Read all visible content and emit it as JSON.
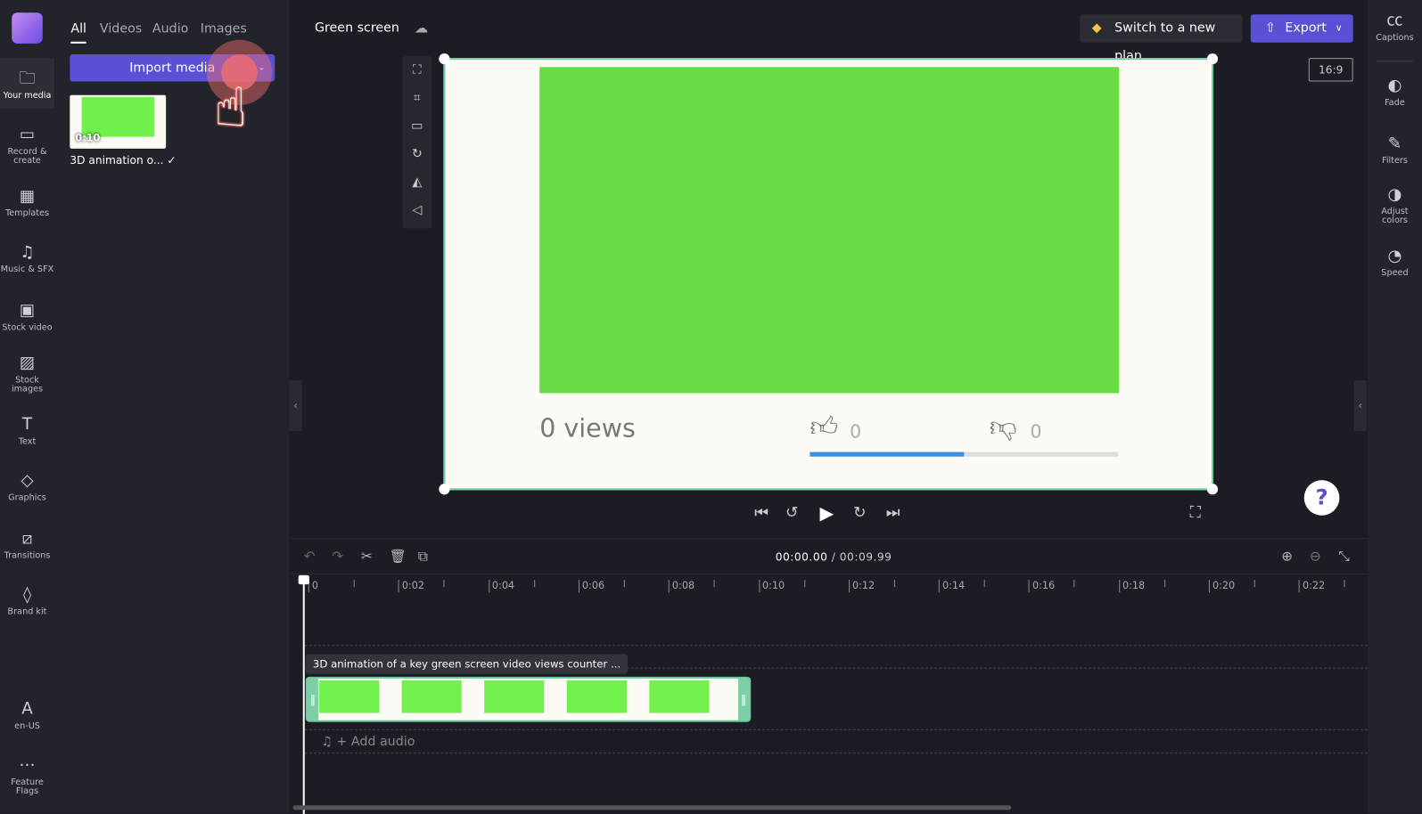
{
  "nav": [
    {
      "label": "Your media",
      "icon": "folder-icon"
    },
    {
      "label": "Record & create",
      "icon": "camera-icon"
    },
    {
      "label": "Templates",
      "icon": "templates-icon"
    },
    {
      "label": "Music & SFX",
      "icon": "music-icon"
    },
    {
      "label": "Stock video",
      "icon": "film-icon"
    },
    {
      "label": "Stock images",
      "icon": "image-icon"
    },
    {
      "label": "Text",
      "icon": "text-icon"
    },
    {
      "label": "Graphics",
      "icon": "shapes-icon"
    },
    {
      "label": "Transitions",
      "icon": "transitions-icon"
    },
    {
      "label": "Brand kit",
      "icon": "brand-icon"
    },
    {
      "label": "en-US",
      "icon": "language-icon"
    },
    {
      "label": "Feature Flags",
      "icon": "more-icon"
    }
  ],
  "panel": {
    "tabs": [
      "All",
      "Videos",
      "Audio",
      "Images"
    ],
    "import_label": "Import media",
    "media": [
      {
        "duration": "0:10",
        "name": "3D animation o..."
      }
    ]
  },
  "header": {
    "project_title": "Green screen",
    "plan_label": "Switch to a new plan",
    "export_label": "Export",
    "aspect_ratio": "16:9"
  },
  "preview": {
    "views_text": "0 views",
    "likes": "0",
    "dislikes": "0",
    "like_ratio": 0.5
  },
  "right": [
    {
      "label": "Captions",
      "icon": "captions-icon"
    },
    {
      "label": "Fade",
      "icon": "fade-icon"
    },
    {
      "label": "Filters",
      "icon": "filters-icon"
    },
    {
      "label": "Adjust colors",
      "icon": "adjust-colors-icon"
    },
    {
      "label": "Speed",
      "icon": "speed-icon"
    }
  ],
  "timeline": {
    "current": "00:00.00",
    "total": "00:09.99",
    "separator": " / ",
    "ticks": [
      "0",
      "0:02",
      "0:04",
      "0:06",
      "0:08",
      "0:10",
      "0:12",
      "0:14",
      "0:16",
      "0:18",
      "0:20",
      "0:22"
    ],
    "clip_title": "3D animation of a key green screen video views counter ...",
    "add_audio": "+ Add audio",
    "help": "?"
  }
}
